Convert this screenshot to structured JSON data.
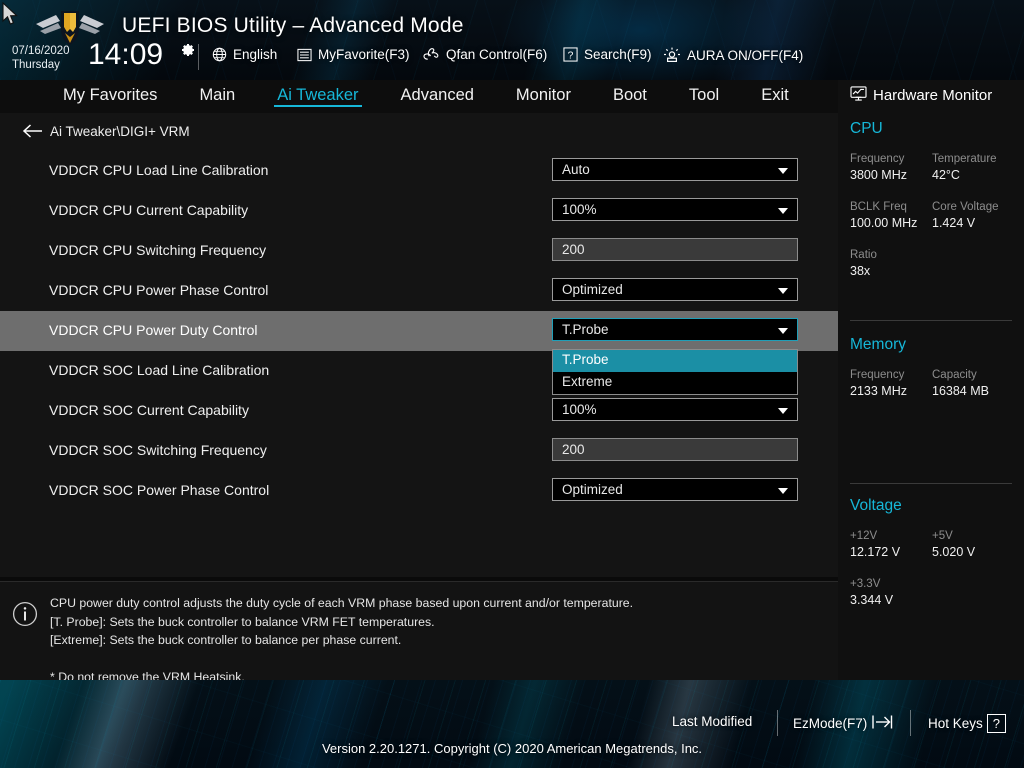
{
  "header": {
    "title": "UEFI BIOS Utility – Advanced Mode",
    "date": "07/16/2020",
    "weekday": "Thursday",
    "time": "14:09",
    "gear_icon": "gear-icon",
    "logo_icon": "tuf-gaming-logo-icon",
    "cursor_icon": "mouse-cursor-icon",
    "items": [
      {
        "label": "English",
        "icon": "globe-icon"
      },
      {
        "label": "MyFavorite(F3)",
        "icon": "list-icon"
      },
      {
        "label": "Qfan Control(F6)",
        "icon": "fan-icon"
      },
      {
        "label": "Search(F9)",
        "icon": "question-box-icon"
      },
      {
        "label": "AURA ON/OFF(F4)",
        "icon": "aura-light-icon"
      }
    ]
  },
  "nav": {
    "tabs": [
      {
        "label": "My Favorites",
        "active": false
      },
      {
        "label": "Main",
        "active": false
      },
      {
        "label": "Ai Tweaker",
        "active": true
      },
      {
        "label": "Advanced",
        "active": false
      },
      {
        "label": "Monitor",
        "active": false
      },
      {
        "label": "Boot",
        "active": false
      },
      {
        "label": "Tool",
        "active": false
      },
      {
        "label": "Exit",
        "active": false
      }
    ],
    "accent_color": "#16b7d8"
  },
  "breadcrumb": {
    "back_icon": "back-arrow-icon",
    "path": "Ai Tweaker\\DIGI+ VRM"
  },
  "settings": {
    "rows": [
      {
        "label": "VDDCR CPU Load Line Calibration",
        "value": "Auto",
        "type": "combo",
        "selected": false
      },
      {
        "label": "VDDCR CPU Current Capability",
        "value": "100%",
        "type": "combo",
        "selected": false
      },
      {
        "label": "VDDCR CPU Switching Frequency",
        "value": "200",
        "type": "text",
        "selected": false
      },
      {
        "label": "VDDCR CPU Power Phase Control",
        "value": "Optimized",
        "type": "combo",
        "selected": false
      },
      {
        "label": "VDDCR CPU Power Duty Control",
        "value": "T.Probe",
        "type": "combo",
        "selected": true
      },
      {
        "label": "VDDCR SOC Load Line Calibration",
        "value": "",
        "type": "none",
        "selected": false
      },
      {
        "label": "VDDCR SOC Current Capability",
        "value": "100%",
        "type": "combo",
        "selected": false
      },
      {
        "label": "VDDCR SOC Switching Frequency",
        "value": "200",
        "type": "text",
        "selected": false
      },
      {
        "label": "VDDCR SOC Power Phase Control",
        "value": "Optimized",
        "type": "combo",
        "selected": false
      }
    ],
    "highlight_color": "#6e6e6e"
  },
  "dropdown": {
    "open": true,
    "options": [
      {
        "label": "T.Probe",
        "selected": true
      },
      {
        "label": "Extreme",
        "selected": false
      }
    ],
    "selected_color": "#1b8fa5"
  },
  "help": {
    "icon": "info-icon",
    "text": "CPU power duty control adjusts the duty cycle of each VRM phase based upon current and/or temperature.\n[T. Probe]: Sets the buck controller to balance VRM FET temperatures.\n[Extreme]: Sets the buck controller to balance per phase current.\n\n* Do not remove the VRM Heatsink."
  },
  "hardware_monitor": {
    "title": "Hardware Monitor",
    "title_icon": "monitor-icon",
    "sections": [
      {
        "name": "CPU",
        "entries": [
          {
            "key": "Frequency",
            "value": "3800 MHz"
          },
          {
            "key": "Temperature",
            "value": "42°C"
          },
          {
            "key": "BCLK Freq",
            "value": "100.00 MHz"
          },
          {
            "key": "Core Voltage",
            "value": "1.424 V"
          },
          {
            "key": "Ratio",
            "value": "38x"
          }
        ]
      },
      {
        "name": "Memory",
        "entries": [
          {
            "key": "Frequency",
            "value": "2133 MHz"
          },
          {
            "key": "Capacity",
            "value": "16384 MB"
          }
        ]
      },
      {
        "name": "Voltage",
        "entries": [
          {
            "key": "+12V",
            "value": "12.172 V"
          },
          {
            "key": "+5V",
            "value": "5.020 V"
          },
          {
            "key": "+3.3V",
            "value": "3.344 V"
          }
        ]
      }
    ],
    "accent_color": "#16b7d8"
  },
  "footer": {
    "last_modified": "Last Modified",
    "ezmode": "EzMode(F7)",
    "ezmode_icon": "exit-arrow-icon",
    "hotkeys": "Hot Keys",
    "hotkeys_key": "?",
    "version": "Version 2.20.1271. Copyright (C) 2020 American Megatrends, Inc."
  }
}
